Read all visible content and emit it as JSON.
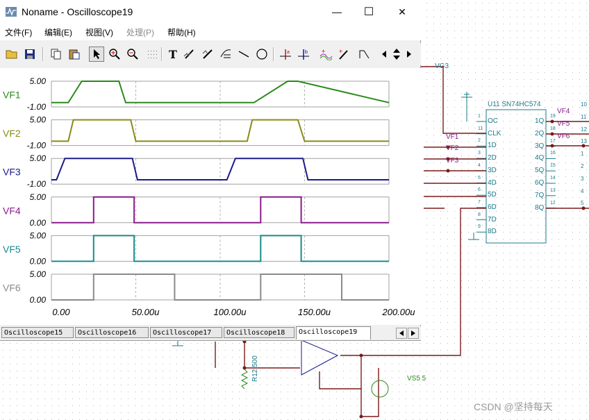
{
  "window": {
    "title": "Noname - Oscilloscope19",
    "minimize_glyph": "—",
    "maximize_glyph": "☐",
    "close_glyph": "✕"
  },
  "menu": [
    "文件(F)",
    "编辑(E)",
    "视图(V)",
    "处理(P)",
    "帮助(H)"
  ],
  "menu_disabled": [
    false,
    false,
    false,
    true,
    false
  ],
  "toolbar_text_tool": "T",
  "tabs": [
    "Oscilloscope15",
    "Oscilloscope16",
    "Oscilloscope17",
    "Oscilloscope18",
    "Oscilloscope19"
  ],
  "active_tab": 4,
  "chart_data": {
    "type": "line",
    "x_ticks": [
      "0.00",
      "50.00u",
      "100.00u",
      "150.00u",
      "200.00u"
    ],
    "xlim": [
      0,
      200
    ],
    "grid": true,
    "channels": [
      {
        "name": "VF1",
        "color": "#2a8a1a",
        "ytop": "5.00",
        "ybot": "-1.00",
        "ylim": [
          -1,
          5
        ],
        "x": [
          0,
          10,
          18,
          40,
          44,
          120,
          140,
          146,
          200
        ],
        "y": [
          0,
          0,
          5,
          5,
          0,
          0,
          5,
          5,
          0
        ]
      },
      {
        "name": "VF2",
        "color": "#8a8a16",
        "ytop": "5.00",
        "ybot": "-1.00",
        "ylim": [
          -1,
          5
        ],
        "x": [
          0,
          10,
          13,
          47,
          50,
          116,
          119,
          146,
          150,
          200
        ],
        "y": [
          0,
          0,
          5,
          5,
          0,
          0,
          5,
          5,
          0,
          0
        ]
      },
      {
        "name": "VF3",
        "color": "#1a1a8a",
        "ytop": "5.00",
        "ybot": "-1.00",
        "ylim": [
          -1,
          5
        ],
        "x": [
          0,
          3,
          8,
          48,
          51,
          104,
          109,
          149,
          152,
          200
        ],
        "y": [
          0,
          0,
          5,
          5,
          0,
          0,
          5,
          5,
          0,
          0
        ]
      },
      {
        "name": "VF4",
        "color": "#8a1a8a",
        "ytop": "5.00",
        "ybot": "0.00",
        "ylim": [
          0,
          5
        ],
        "x": [
          0,
          25,
          25,
          49,
          49,
          124,
          124,
          148,
          148,
          200
        ],
        "y": [
          0,
          0,
          5,
          5,
          0,
          0,
          5,
          5,
          0,
          0
        ]
      },
      {
        "name": "VF5",
        "color": "#1a8a8a",
        "ytop": "5.00",
        "ybot": "0.00",
        "ylim": [
          0,
          5
        ],
        "x": [
          0,
          25,
          25,
          49,
          49,
          124,
          124,
          148,
          148,
          200
        ],
        "y": [
          0,
          0,
          5,
          5,
          0,
          0,
          5,
          5,
          0,
          0
        ]
      },
      {
        "name": "VF6",
        "color": "#8a8a8a",
        "ytop": "5.00",
        "ybot": "0.00",
        "ylim": [
          0,
          5
        ],
        "x": [
          0,
          25,
          25,
          73,
          73,
          124,
          124,
          172,
          172,
          200
        ],
        "y": [
          0,
          0,
          5,
          5,
          0,
          0,
          5,
          5,
          0,
          0
        ]
      }
    ]
  },
  "schematic": {
    "chip_name": "U11 SN74HC574",
    "left_pins": [
      "OC",
      "CLK",
      "1D",
      "2D",
      "3D",
      "4D",
      "5D",
      "6D",
      "7D",
      "8D"
    ],
    "right_pins": [
      "1Q",
      "2Q",
      "3Q",
      "4Q",
      "5Q",
      "6Q",
      "7Q",
      "8Q"
    ],
    "left_pin_numbers": [
      "1",
      "11",
      "2",
      "3",
      "4",
      "5",
      "6",
      "7",
      "8",
      "9"
    ],
    "right_pin_numbers": [
      "19",
      "18",
      "17",
      "16",
      "15",
      "14",
      "13",
      "12"
    ],
    "labels": [
      "VG3",
      "VF1",
      "VF2",
      "VF3",
      "VF4",
      "VF5",
      "VF6",
      "R12 500",
      "VS5 5"
    ],
    "far_right_numbers": [
      "10",
      "11",
      "12",
      "13",
      "1",
      "2",
      "3",
      "4",
      "5"
    ]
  },
  "watermark": "CSDN @坚持每天"
}
